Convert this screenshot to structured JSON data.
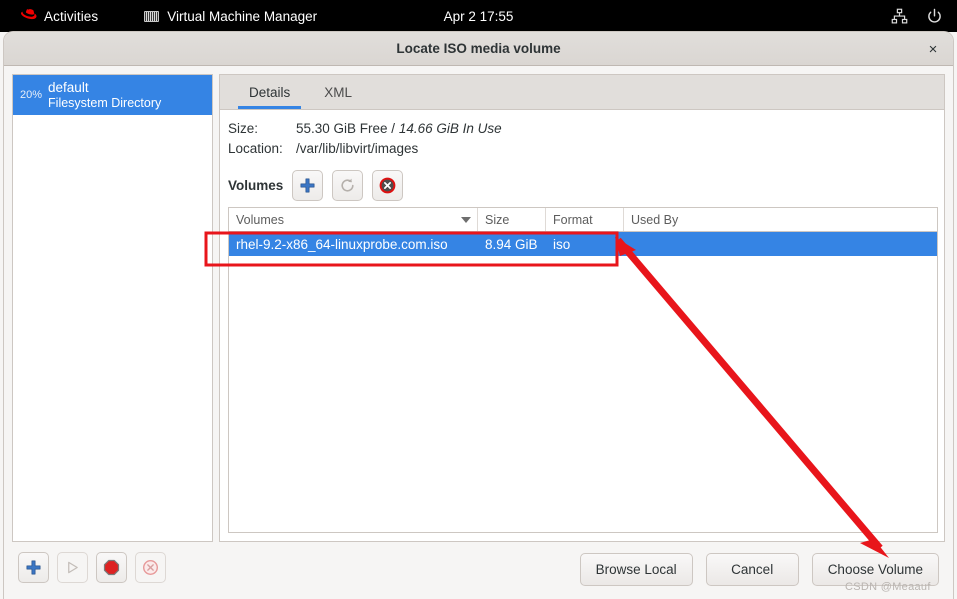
{
  "topbar": {
    "activities": "Activities",
    "app_name": "Virtual Machine Manager",
    "clock": "Apr 2  17:55",
    "icons": {
      "redhat": "redhat-logo-icon",
      "app": "vmm-icon",
      "network": "network-icon",
      "power": "power-icon"
    }
  },
  "dialog": {
    "title": "Locate ISO media volume",
    "close_label": "×"
  },
  "sidebar": {
    "pools": [
      {
        "percent": "20%",
        "name": "default",
        "type": "Filesystem Directory"
      }
    ],
    "toolbar": [
      {
        "name": "add-pool-button",
        "icon": "plus-icon",
        "enabled": true
      },
      {
        "name": "start-pool-button",
        "icon": "play-icon",
        "enabled": false
      },
      {
        "name": "stop-pool-button",
        "icon": "stop-icon",
        "enabled": true
      },
      {
        "name": "delete-pool-button",
        "icon": "delete-icon",
        "enabled": false
      }
    ]
  },
  "details": {
    "tabs": [
      {
        "label": "Details",
        "active": true
      },
      {
        "label": "XML",
        "active": false
      }
    ],
    "size_label": "Size:",
    "size_free": "55.30 GiB Free",
    "size_sep": " / ",
    "size_inuse": "14.66 GiB In Use",
    "location_label": "Location:",
    "location_value": "/var/lib/libvirt/images",
    "volumes_label": "Volumes",
    "volume_toolbar": [
      {
        "name": "add-volume-button",
        "icon": "plus-icon",
        "enabled": true
      },
      {
        "name": "refresh-volumes-button",
        "icon": "refresh-icon",
        "enabled": false
      },
      {
        "name": "delete-volume-button",
        "icon": "delete-icon",
        "enabled": true
      }
    ],
    "table": {
      "columns": [
        "Volumes",
        "Size",
        "Format",
        "Used By"
      ],
      "sorted_column": "Volumes",
      "rows": [
        {
          "volume": "rhel-9.2-x86_64-linuxprobe.com.iso",
          "size": "8.94 GiB",
          "format": "iso",
          "used_by": "",
          "selected": true
        }
      ]
    }
  },
  "footer": {
    "browse_local": "Browse Local",
    "cancel": "Cancel",
    "choose_volume": "Choose Volume"
  },
  "annotations": {
    "highlight_color": "#e8151b",
    "arrow_color": "#e8151b",
    "watermark": "CSDN @Meaauf"
  },
  "colors": {
    "selection_blue": "#3584e4",
    "titlebar": "#ddd9d5",
    "window_bg": "#f6f5f4",
    "topbar": "#000000"
  }
}
